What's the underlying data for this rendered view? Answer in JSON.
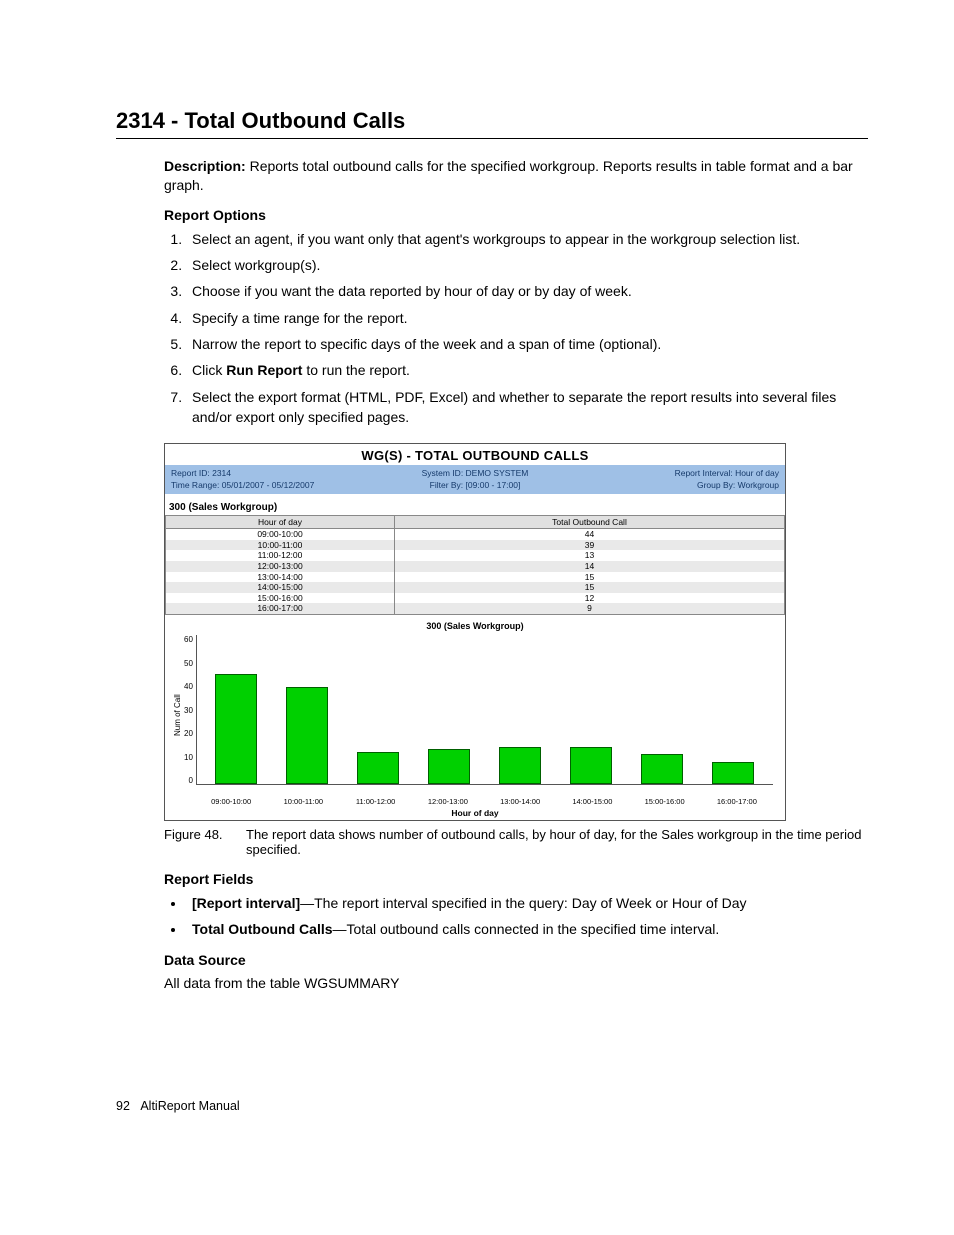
{
  "title": "2314 - Total Outbound Calls",
  "description_label": "Description:",
  "description_text": " Reports total outbound calls for the specified workgroup. Reports results in table format and a bar graph.",
  "report_options_heading": "Report Options",
  "options": [
    "Select an agent, if you want only that agent's workgroups to appear in the workgroup selection list.",
    "Select workgroup(s).",
    "Choose if you want the data reported by hour of day or by day of week.",
    "Specify a time range for the report.",
    "Narrow the report to specific days of the week and a span of time (optional).",
    "Click Run Report to run the report.",
    "Select the export format (HTML, PDF, Excel) and whether to separate the report results into several files and/or export only specified pages."
  ],
  "option6_pre": "Click ",
  "option6_bold": "Run Report",
  "option6_post": " to run the report.",
  "report_box": {
    "title": "WG(S) - TOTAL OUTBOUND CALLS",
    "left1": "Report ID: 2314",
    "mid1": "System ID: DEMO SYSTEM",
    "right1": "Report Interval: Hour of day",
    "left2": "Time Range: 05/01/2007 - 05/12/2007",
    "mid2": "Filter By: [09:00 - 17:00]",
    "right2": "Group By: Workgroup",
    "workgroup_name": "300 (Sales Workgroup)",
    "col1": "Hour of day",
    "col2": "Total Outbound Call"
  },
  "chart_data": {
    "type": "bar",
    "title": "300 (Sales Workgroup)",
    "xlabel": "Hour of day",
    "ylabel": "Num of Call",
    "ylim": [
      0,
      60
    ],
    "yticks": [
      0,
      10,
      20,
      30,
      40,
      50,
      60
    ],
    "categories": [
      "09:00-10:00",
      "10:00-11:00",
      "11:00-12:00",
      "12:00-13:00",
      "13:00-14:00",
      "14:00-15:00",
      "15:00-16:00",
      "16:00-17:00"
    ],
    "values": [
      44,
      39,
      13,
      14,
      15,
      15,
      12,
      9
    ]
  },
  "figure_number": "Figure 48.",
  "figure_caption": "The report data shows number of outbound calls, by hour of day, for the Sales workgroup in the time period specified.",
  "report_fields_heading": "Report Fields",
  "fields": {
    "f1_bold": "[Report interval]",
    "f1_text": "—The report interval specified in the query: Day of Week or Hour of Day",
    "f2_bold": "Total Outbound Calls",
    "f2_text": "—Total outbound calls connected in the specified time interval."
  },
  "data_source_heading": "Data Source",
  "data_source_text": "All data from the table WGSUMMARY",
  "footer_page": "92",
  "footer_doc": "AltiReport Manual"
}
